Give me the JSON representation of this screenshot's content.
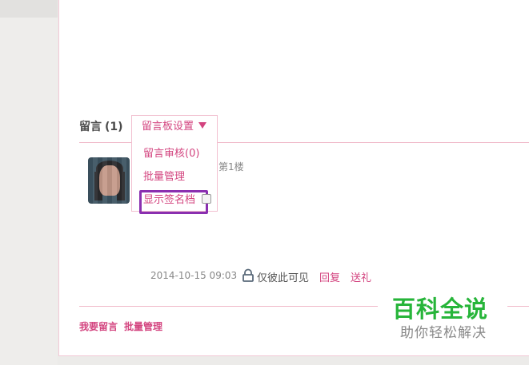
{
  "guestbook": {
    "heading": "留言",
    "count": "(1)",
    "board_setting_label": "留言板设置",
    "menu": {
      "review": "留言审核(0)",
      "batch": "批量管理",
      "show_signature": "显示签名档"
    },
    "entry": {
      "floor": "第1楼",
      "timestamp": "2014-10-15 09:03",
      "visibility": "仅彼此可见",
      "reply": "回复",
      "gift": "送礼"
    },
    "footer": {
      "leave_message": "我要留言",
      "batch_manage": "批量管理"
    }
  },
  "watermark": {
    "title": "百科全说",
    "subtitle": "助你轻松解决"
  },
  "colors": {
    "accent": "#d3447f",
    "highlight": "#8a2fb0",
    "watermark_green": "#27b53a",
    "divider": "#f0b8c8"
  },
  "icons": {
    "dropdown": "caret-down-icon",
    "privacy": "lock-icon"
  }
}
